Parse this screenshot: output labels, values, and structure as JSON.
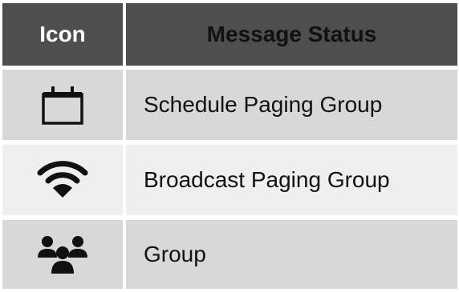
{
  "table": {
    "headers": {
      "icon": "Icon",
      "status": "Message Status"
    },
    "rows": [
      {
        "icon": "calendar-icon",
        "label": "Schedule Paging Group"
      },
      {
        "icon": "wifi-icon",
        "label": "Broadcast Paging Group"
      },
      {
        "icon": "group-icon",
        "label": "Group"
      }
    ]
  },
  "colors": {
    "header_bg": "#4d4e50",
    "row_gray": "#d8d8d8",
    "row_light": "#efefef",
    "icon": "#111111"
  }
}
